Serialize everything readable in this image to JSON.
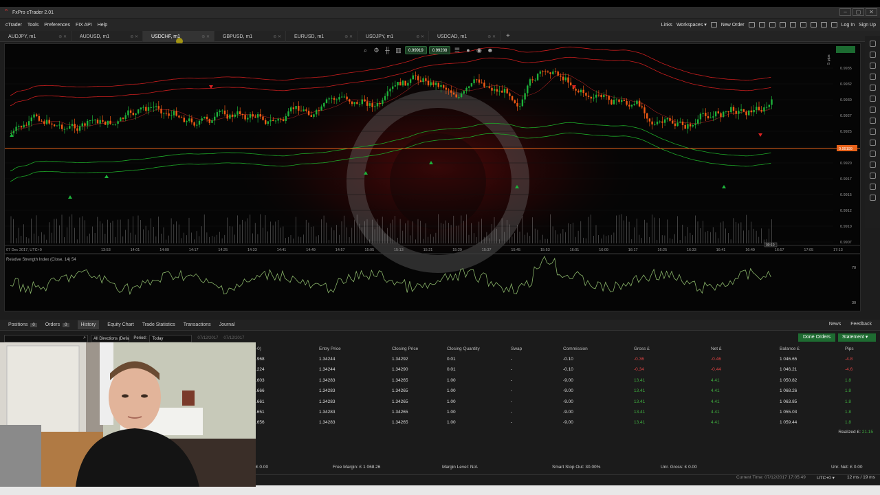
{
  "window": {
    "title": "FxPro cTrader 2.01",
    "controls": [
      "–",
      "▢",
      "✕"
    ]
  },
  "menu": {
    "items": [
      "cTrader",
      "Tools",
      "Preferences",
      "FIX API",
      "Help"
    ],
    "right": {
      "links": "Links",
      "workspaces": "Workspaces ▾",
      "new_order": "New Order",
      "log_in": "Log In",
      "sign_up": "Sign Up"
    }
  },
  "tabs": [
    {
      "label": "AUDJPY, m1",
      "active": false
    },
    {
      "label": "AUDUSD, m1",
      "active": false
    },
    {
      "label": "USDCHF, m1",
      "active": true
    },
    {
      "label": "GBPUSD, m1",
      "active": false
    },
    {
      "label": "EURUSD, m1",
      "active": false
    },
    {
      "label": "USDJPY, m1",
      "active": false
    },
    {
      "label": "USDCAD, m1",
      "active": false
    }
  ],
  "chart": {
    "sell_price": "0.99919",
    "buy_price": "0.99208",
    "price_axis": [
      "0.9935",
      "0.9932",
      "0.9930",
      "0.9927",
      "0.9925",
      "0.9922",
      "0.9920",
      "0.9917",
      "0.9915",
      "0.9912",
      "0.9910",
      "0.9907"
    ],
    "time_axis": [
      "07 Dec 2017, UTC+0",
      "13:53",
      "14:01",
      "14:09",
      "14:17",
      "14:25",
      "14:33",
      "14:41",
      "14:49",
      "14:57",
      "15:05",
      "15:13",
      "15:21",
      "15:29",
      "15:37",
      "15:45",
      "15:53",
      "16:01",
      "16:09",
      "16:17",
      "16:25",
      "16:33",
      "16:41",
      "16:49",
      "16:57",
      "17:05",
      "17:13",
      "17:21"
    ],
    "current_price_tag": "0.99199",
    "pips_label": "5 pips",
    "timer_label": "00:10",
    "rsi_label": "Relative Strength Index (Close, 14) 54",
    "rsi_axis": [
      "70",
      "30"
    ],
    "colors": {
      "up": "#1db23a",
      "down": "#f05a14",
      "bg": "#050505",
      "upper_band": "#c81e1e",
      "lower_band": "#1ea828",
      "price_line": "#e8621a"
    }
  },
  "bottom": {
    "tabs": [
      {
        "label": "Positions",
        "count": "0"
      },
      {
        "label": "Orders",
        "count": "0"
      },
      {
        "label": "History",
        "count": ""
      },
      {
        "label": "Equity Chart",
        "count": ""
      },
      {
        "label": "Trade Statistics",
        "count": ""
      },
      {
        "label": "Transactions",
        "count": ""
      },
      {
        "label": "Journal",
        "count": ""
      }
    ],
    "news": "News",
    "feedback": "Feedback",
    "filter_direction": "All Directions (Defa",
    "period_label": "Period:",
    "period_value": "Today",
    "date_from": "07/12/2017",
    "date_to": "07/12/2017",
    "done_orders": "Done Orders",
    "statement": "Statement ▾",
    "columns": [
      "ID",
      "Entry Price",
      "Closing Price",
      "Closing Quantity",
      "Swap",
      "Commission",
      "Gross £",
      "Net £",
      "Balance £",
      "Pips"
    ],
    "columns_visible": [
      "‑0)",
      "Entry Price",
      "Closing Price",
      "Closing Quantity",
      "Swap",
      "Commission",
      "Gross £",
      "Net £",
      "Balance £",
      "Pips"
    ],
    "rows": [
      {
        "id": ".968",
        "entry": "1.34244",
        "close": "1.34292",
        "qty": "0.01",
        "swap": "-",
        "comm": "-0.10",
        "gross": "-0.36",
        "net": "-0.46",
        "balance": "1 046.65",
        "pips": "-4.8"
      },
      {
        "id": ".224",
        "entry": "1.34244",
        "close": "1.34290",
        "qty": "0.01",
        "swap": "-",
        "comm": "-0.10",
        "gross": "-0.34",
        "net": "-0.44",
        "balance": "1 046.21",
        "pips": "-4.6"
      },
      {
        "id": ".603",
        "entry": "1.34283",
        "close": "1.34265",
        "qty": "1.00",
        "swap": "-",
        "comm": "-9.00",
        "gross": "13.41",
        "net": "4.41",
        "balance": "1 050.82",
        "pips": "1.8"
      },
      {
        "id": ".666",
        "entry": "1.34283",
        "close": "1.34265",
        "qty": "1.00",
        "swap": "-",
        "comm": "-9.00",
        "gross": "13.41",
        "net": "4.41",
        "balance": "1 068.26",
        "pips": "1.8"
      },
      {
        "id": ".661",
        "entry": "1.34283",
        "close": "1.34265",
        "qty": "1.00",
        "swap": "-",
        "comm": "-9.00",
        "gross": "13.41",
        "net": "4.41",
        "balance": "1 063.85",
        "pips": "1.8"
      },
      {
        "id": ".651",
        "entry": "1.34283",
        "close": "1.34265",
        "qty": "1.00",
        "swap": "-",
        "comm": "-9.00",
        "gross": "13.41",
        "net": "4.41",
        "balance": "1 055.03",
        "pips": "1.8"
      },
      {
        "id": ".656",
        "entry": "1.34283",
        "close": "1.34265",
        "qty": "1.00",
        "swap": "-",
        "comm": "-9.00",
        "gross": "13.41",
        "net": "4.41",
        "balance": "1 059.44",
        "pips": "1.8"
      }
    ],
    "realized_label": "Realized £:",
    "realized_value": "21.15",
    "status": {
      "balance": "£ 0.00",
      "free_margin": "Free Margin: £ 1 068.26",
      "margin_level": "Margin Level: N/A",
      "stop_out": "Smart Stop Out: 30.00%",
      "unr_gross": "Unr. Gross: £ 0.00",
      "unr_net": "Unr. Net: £ 0.00"
    },
    "footer": {
      "current_time": "Current Time: 07/12/2017 17:05:49",
      "tz": "UTC+0 ▾",
      "latency": "12 ms / 19 ms"
    }
  }
}
